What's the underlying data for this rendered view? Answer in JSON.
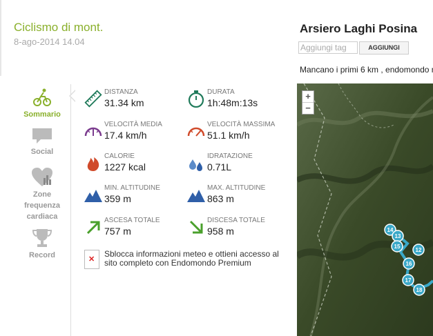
{
  "sport": {
    "title": "Ciclismo di mont.",
    "date": "8-ago-2014 14.04"
  },
  "nav": {
    "items": [
      {
        "label": "Sommario",
        "icon": "cyclist-icon",
        "active": true
      },
      {
        "label": "Social",
        "icon": "speech-bubble-icon",
        "active": false
      },
      {
        "label": "Zone frequenza cardiaca",
        "icon": "heart-chart-icon",
        "active": false
      },
      {
        "label": "Record",
        "icon": "trophy-icon",
        "active": false
      }
    ]
  },
  "stats": {
    "distance": {
      "label": "DISTANZA",
      "value": "31.34 km",
      "icon": "ruler-icon"
    },
    "duration": {
      "label": "DURATA",
      "value": "1h:48m:13s",
      "icon": "stopwatch-icon"
    },
    "avg_speed": {
      "label": "VELOCITÀ MEDIA",
      "value": "17.4 km/h",
      "icon": "speedometer-icon"
    },
    "max_speed": {
      "label": "VELOCITÀ MASSIMA",
      "value": "51.1 km/h",
      "icon": "speedometer-icon"
    },
    "calories": {
      "label": "CALORIE",
      "value": "1227 kcal",
      "icon": "flame-icon"
    },
    "hydration": {
      "label": "IDRATAZIONE",
      "value": "0.71L",
      "icon": "water-drops-icon"
    },
    "min_alt": {
      "label": "MIN. ALTITUDINE",
      "value": "359 m",
      "icon": "mountain-icon"
    },
    "max_alt": {
      "label": "MAX. ALTITUDINE",
      "value": "863 m",
      "icon": "mountain-icon"
    },
    "ascent": {
      "label": "ASCESA TOTALE",
      "value": "757 m",
      "icon": "arrow-up-right-icon"
    },
    "descent": {
      "label": "DISCESA TOTALE",
      "value": "958 m",
      "icon": "arrow-down-right-icon"
    }
  },
  "premium": {
    "text": "Sblocca informazioni meteo e ottieni accesso al sito completo con Endomondo Premium"
  },
  "workout": {
    "title": "Arsiero Laghi Posina",
    "tag_placeholder": "Aggiungi tag",
    "tag_button": "AGGIUNGI",
    "description": "Mancano i primi 6 km , endomondo n"
  },
  "map": {
    "zoom_in": "+",
    "zoom_out": "−",
    "markers": [
      "14",
      "13",
      "15",
      "12",
      "16",
      "17",
      "18"
    ]
  },
  "colors": {
    "accent": "#8ab02c",
    "route": "#3aa8c8",
    "icon_teal": "#1f7a5a",
    "icon_purple": "#7b3b8e",
    "icon_red": "#d04a2a",
    "icon_blue": "#2f5fa8"
  }
}
